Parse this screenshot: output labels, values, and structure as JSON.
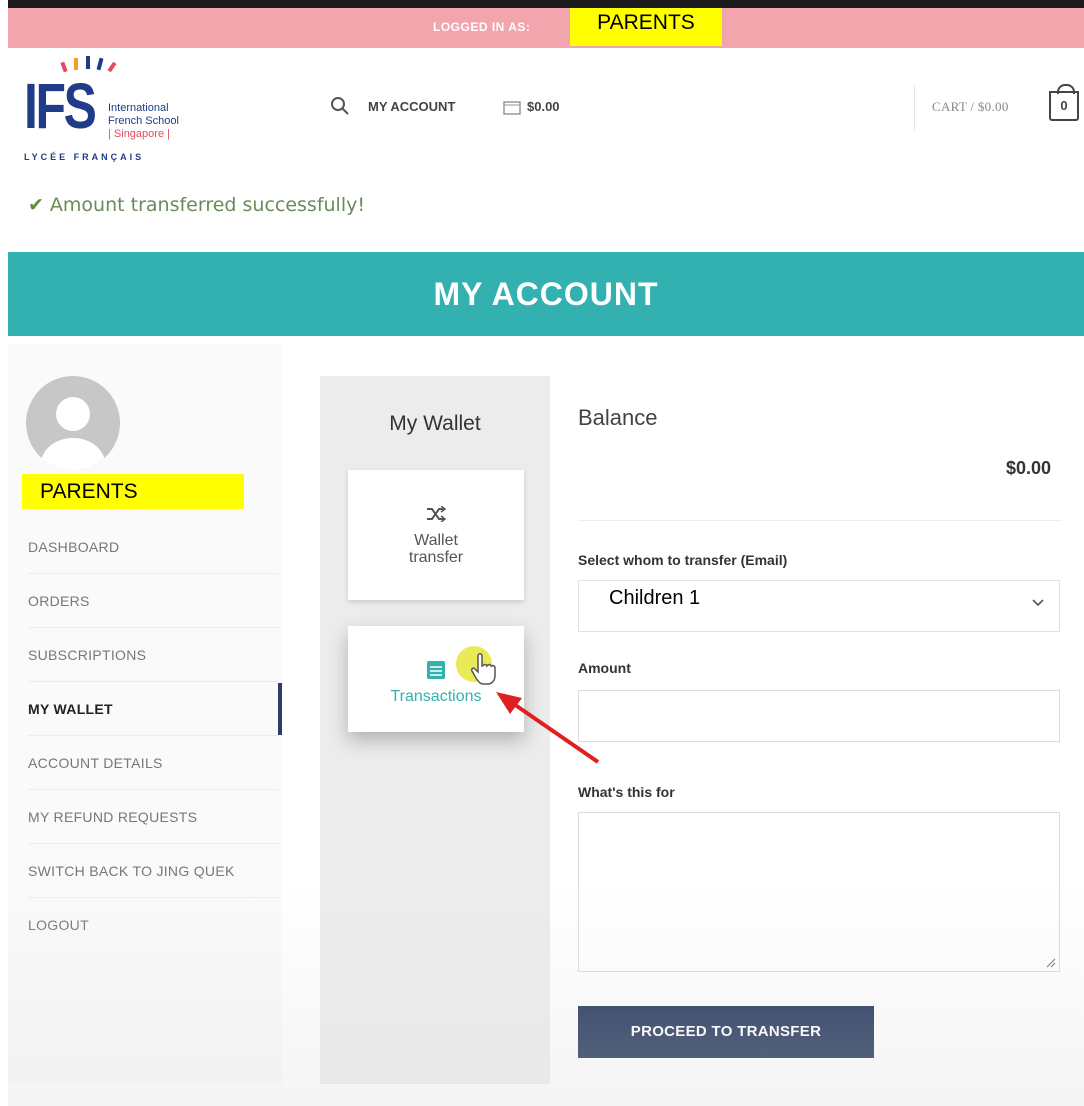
{
  "topbar": {
    "logged_in_label": "LOGGED IN AS:",
    "role": "PARENTS"
  },
  "logo": {
    "brand": "IFS",
    "line1": "International",
    "line2": "French School",
    "line3": "| Singapore |",
    "tagline": "LYCÉE FRANÇAIS"
  },
  "header": {
    "my_account": "MY ACCOUNT",
    "wallet_total": "$0.00",
    "cart_label": "CART / $0.00",
    "cart_count": "0"
  },
  "notice": {
    "message": "Amount transferred successfully!"
  },
  "banner": {
    "title": "MY ACCOUNT"
  },
  "sidebar": {
    "user_role": "PARENTS",
    "items": [
      {
        "label": "DASHBOARD"
      },
      {
        "label": "ORDERS"
      },
      {
        "label": "SUBSCRIPTIONS"
      },
      {
        "label": "MY WALLET",
        "active": true
      },
      {
        "label": "ACCOUNT DETAILS"
      },
      {
        "label": "MY REFUND REQUESTS"
      },
      {
        "label": "SWITCH BACK TO JING QUEK"
      },
      {
        "label": "LOGOUT"
      }
    ]
  },
  "wallet": {
    "title": "My Wallet",
    "cards": [
      {
        "label_line1": "Wallet",
        "label_line2": "transfer",
        "icon": "shuffle-icon"
      },
      {
        "label": "Transactions",
        "icon": "list-icon"
      }
    ]
  },
  "form": {
    "balance_title": "Balance",
    "balance_value": "$0.00",
    "email_label": "Select whom to transfer (Email)",
    "email_selected": "Children 1",
    "amount_label": "Amount",
    "amount_value": "",
    "purpose_label": "What's this for",
    "purpose_value": "",
    "submit_label": "PROCEED TO TRANSFER"
  },
  "colors": {
    "topbar_pink": "#f2a5ac",
    "highlight_yellow": "#ffff00",
    "teal": "#33b1b1",
    "navy_button": "#1c2f56",
    "success_green": "#5a8f3c",
    "annotation_red": "#e02020"
  }
}
